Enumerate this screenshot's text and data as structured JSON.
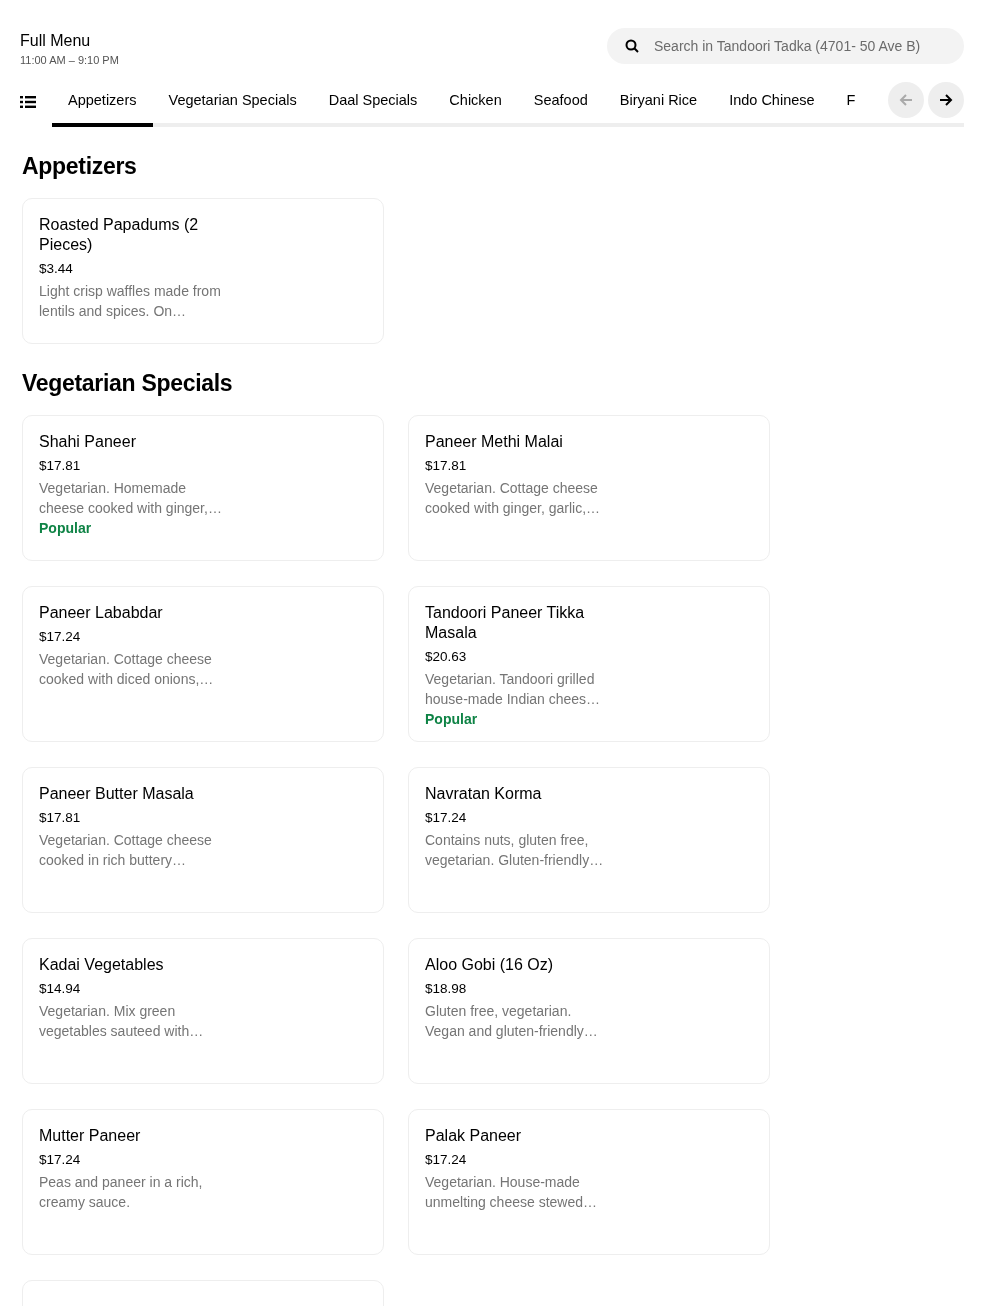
{
  "header": {
    "title": "Full Menu",
    "hours": "11:00 AM – 9:10 PM"
  },
  "search": {
    "placeholder": "Search in Tandoori Tadka (4701- 50 Ave B)"
  },
  "tabs": [
    {
      "label": "Appetizers",
      "selected": true
    },
    {
      "label": "Vegetarian Specials",
      "selected": false
    },
    {
      "label": "Daal Specials",
      "selected": false
    },
    {
      "label": "Chicken",
      "selected": false
    },
    {
      "label": "Seafood",
      "selected": false
    },
    {
      "label": "Biryani Rice",
      "selected": false
    },
    {
      "label": "Indo Chinese",
      "selected": false
    },
    {
      "label": "F",
      "selected": false
    }
  ],
  "nav_buttons": [
    {
      "kind": "back",
      "disabled": true
    },
    {
      "kind": "forward",
      "disabled": false
    }
  ],
  "sections": [
    {
      "title": "Appetizers",
      "items": [
        {
          "name": "Roasted Papadums (2 Pieces)",
          "price": "$3.44",
          "description": "Light crisp waffles made from lentils and spices. On…"
        }
      ]
    },
    {
      "title": "Vegetarian Specials",
      "items": [
        {
          "name": "Shahi Paneer",
          "price": "$17.81",
          "description": "Vegetarian. Homemade cheese cooked with ginger,…",
          "badge": "Popular"
        },
        {
          "name": "Paneer Methi Malai",
          "price": "$17.81",
          "description": "Vegetarian. Cottage cheese cooked with ginger, garlic,…"
        },
        {
          "name": "Paneer Lababdar",
          "price": "$17.24",
          "description": "Vegetarian. Cottage cheese cooked with diced onions,…"
        },
        {
          "name": "Tandoori Paneer Tikka Masala",
          "price": "$20.63",
          "description": "Vegetarian. Tandoori grilled house-made Indian chees…",
          "badge": "Popular"
        },
        {
          "name": "Paneer Butter Masala",
          "price": "$17.81",
          "description": "Vegetarian. Cottage cheese cooked in rich buttery…"
        },
        {
          "name": "Navratan Korma",
          "price": "$17.24",
          "description": "Contains nuts, gluten free, vegetarian. Gluten-friendly…"
        },
        {
          "name": "Kadai Vegetables",
          "price": "$14.94",
          "description": "Vegetarian. Mix green vegetables sauteed with…"
        },
        {
          "name": "Aloo Gobi (16 Oz)",
          "price": "$18.98",
          "description": "Gluten free, vegetarian. Vegan and gluten-friendly…"
        },
        {
          "name": "Mutter Paneer",
          "price": "$17.24",
          "description": "Peas and paneer in a rich, creamy sauce."
        },
        {
          "name": "Palak Paneer",
          "price": "$17.24",
          "description": "Vegetarian. House-made unmelting cheese stewed…"
        },
        {
          "kind": "cut"
        }
      ]
    }
  ]
}
